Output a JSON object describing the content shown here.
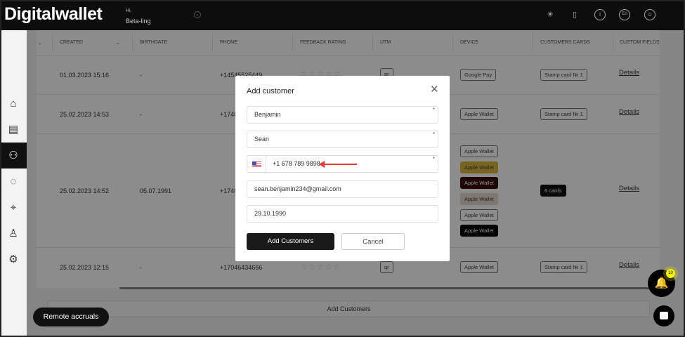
{
  "header": {
    "logo": "Digitalwallet",
    "greeting": "Hi,",
    "user": "Beta-ling",
    "lang": "En"
  },
  "table": {
    "columns": [
      "Created",
      "Birthdate",
      "Phone",
      "Feedback rating",
      "UTM",
      "Device",
      "Customers cards",
      "Custom fields"
    ],
    "rows": [
      {
        "created": "01.03.2023 15:16",
        "birthdate": "-",
        "phone": "+14545525449",
        "utm": "qr",
        "devices": [
          "Google Pay"
        ],
        "cards": "Stamp card № 1",
        "details": "Details"
      },
      {
        "created": "25.02.2023 14:53",
        "birthdate": "-",
        "phone": "+1740",
        "utm": "",
        "devices": [
          "Apple Wallet"
        ],
        "cards": "Stamp card № 1",
        "details": "Details"
      },
      {
        "created": "25.02.2023 14:52",
        "birthdate": "05.07.1991",
        "phone": "+1740",
        "utm": "",
        "devices": [
          "Apple Wallet",
          "Apple Wallet",
          "Apple Wallet",
          "Apple Wallet",
          "Apple Wallet",
          "Apple Wallet"
        ],
        "cards": "6 cards",
        "details": "Details"
      },
      {
        "created": "25.02.2023 12:15",
        "birthdate": "-",
        "phone": "+17046434666",
        "utm": "qr",
        "devices": [
          "Apple Wallet"
        ],
        "cards": "Stamp card № 1",
        "details": "Details"
      }
    ],
    "device_colors": [
      "#ffffff",
      "#d8b73a",
      "#3a0a0a",
      "#e6d8cc",
      "#ffffff",
      "#000000"
    ],
    "add_button": "Add Customers"
  },
  "modal": {
    "title": "Add customer",
    "first_name": "Benjamin",
    "last_name": "Sean",
    "phone": "+1 678 789 9898",
    "email": "sean.benjamin234@gmail.com",
    "birthdate": "29.10.1990",
    "required_mark": "*",
    "submit": "Add Customers",
    "cancel": "Cancel"
  },
  "remote_accruals": "Remote accruals",
  "notifications_count": "10"
}
